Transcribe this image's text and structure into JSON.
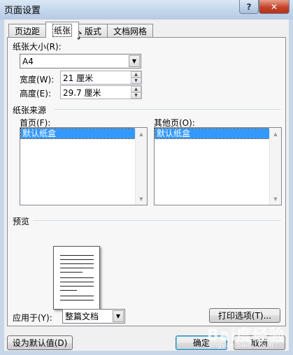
{
  "window": {
    "title": "页面设置",
    "help_label": "?",
    "close_label": "✕"
  },
  "tabs": [
    {
      "label": "页边距"
    },
    {
      "label": "纸张"
    },
    {
      "label": "版式"
    },
    {
      "label": "文档网格"
    }
  ],
  "paper_size": {
    "section_label": "纸张大小(R):",
    "selected": "A4",
    "width_label": "宽度(W):",
    "width_value": "21 厘米",
    "height_label": "高度(E):",
    "height_value": "29.7 厘米"
  },
  "paper_source": {
    "section_label": "纸张来源",
    "first_page_label": "首页(F):",
    "first_page_selected": "默认纸盒",
    "other_pages_label": "其他页(O):",
    "other_pages_selected": "默认纸盒"
  },
  "preview": {
    "section_label": "预览"
  },
  "apply_to": {
    "label": "应用于(Y):",
    "selected": "整篇文档"
  },
  "buttons": {
    "print_options": "打印选项(T)...",
    "set_default": "设为默认值(D)",
    "ok": "确定",
    "cancel": "取消"
  },
  "watermark": {
    "text": "Bai度经验",
    "sub": "jingyan.baidu.com"
  }
}
